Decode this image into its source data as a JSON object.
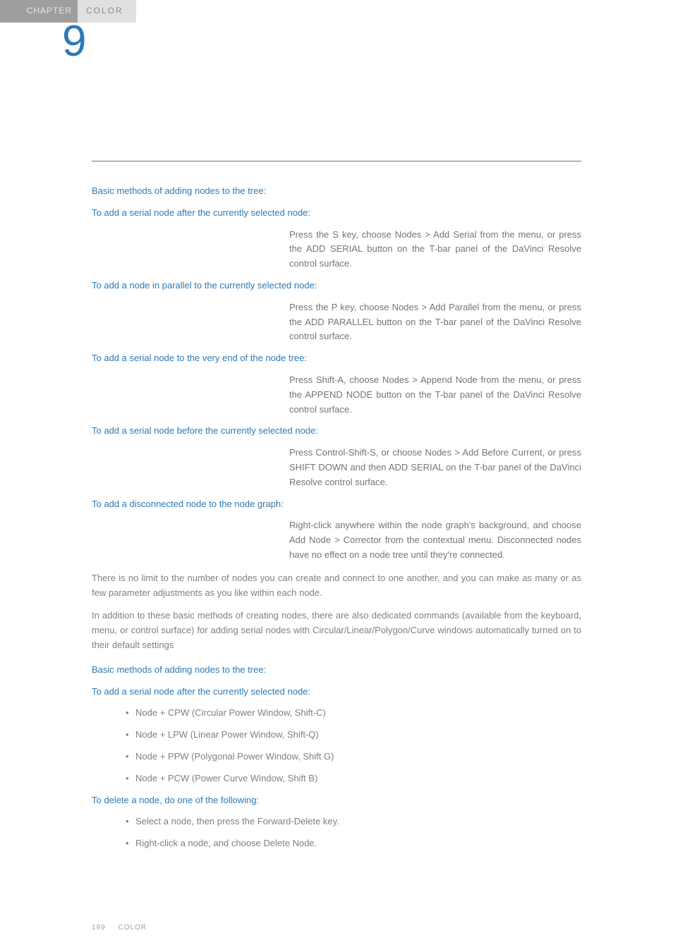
{
  "header": {
    "label": "CHAPTER",
    "title": "COLOR",
    "number": "9"
  },
  "section1": {
    "title": "Basic methods of adding nodes to the tree:",
    "items": [
      {
        "sub": "To add a serial node after the currently selected node:",
        "body": "Press the S key, choose Nodes > Add Serial from the menu, or press the ADD SERIAL button on the T-bar panel of the DaVinci Resolve control surface."
      },
      {
        "sub": "To add a node in parallel to the currently selected node:",
        "body": "Press the P key, choose Nodes > Add Parallel from the menu, or press the ADD PARALLEL button on the T-bar panel of the DaVinci Resolve control surface."
      },
      {
        "sub": "To add a serial node to the very end of the node tree:",
        "body": "Press Shift-A, choose Nodes > Append Node from the menu, or press the APPEND NODE button on the T-bar panel of the DaVinci Resolve control surface."
      },
      {
        "sub": "To add a serial node before the currently selected node:",
        "body": "Press Control-Shift-S, or choose Nodes > Add Before Current, or press SHIFT DOWN and then ADD SERIAL on the T-bar panel of the DaVinci Resolve control surface."
      },
      {
        "sub": "To add a disconnected node to the node graph:",
        "body": "Right-click anywhere within the node graph's background, and choose Add Node > Corrector from the contextual menu. Disconnected nodes have no effect on a node tree until they're connected."
      }
    ]
  },
  "para1": "There is no limit to the number of nodes you can create and connect to one another, and you can make as many or as few parameter adjustments as you like within each node.",
  "para2": "In addition to these basic methods of creating nodes, there are also dedicated commands (available from the keyboard, menu, or control surface) for adding serial nodes with Circular/Linear/Polygon/Curve windows automatically turned on to their default settings",
  "section2": {
    "title": "Basic methods of adding nodes to the tree:",
    "sub": "To add a serial node after the currently selected node:",
    "list": [
      "Node + CPW (Circular Power Window, Shift-C)",
      "Node + LPW (Linear Power Window, Shift-Q)",
      "Node + PPW (Polygonal Power Window, Shift G)",
      "Node + PCW (Power Curve Window, Shift B)"
    ]
  },
  "section3": {
    "title": "To delete a node, do one of the following:",
    "list": [
      "Select a node, then press the Forward-Delete key.",
      "Right-click a node, and choose Delete Node."
    ]
  },
  "footer": {
    "page": "199",
    "label": "COLOR"
  }
}
